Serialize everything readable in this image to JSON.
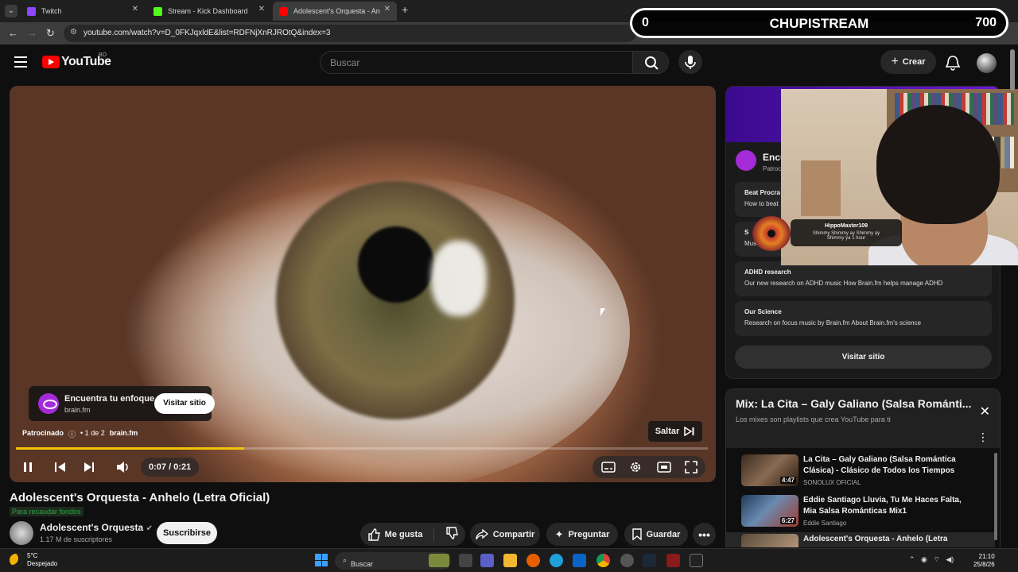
{
  "browser": {
    "tabs": [
      {
        "title": "Twitch",
        "color": "#9146ff"
      },
      {
        "title": "Stream - Kick Dashboard",
        "color": "#53fc18"
      },
      {
        "title": "Adolescent's Orquesta - An",
        "color": "#ff0000"
      }
    ],
    "url": "youtube.com/watch?v=D_0FKJqxldE&list=RDFNjXnRJROtQ&index=3"
  },
  "overlay": {
    "left": "0",
    "title": "CHUPISTREAM",
    "right": "700"
  },
  "youtube": {
    "logo": "YouTube",
    "country": "BO",
    "search_placeholder": "Buscar",
    "create_label": "Crear"
  },
  "player": {
    "ad_title": "Encuentra tu enfoque",
    "ad_domain": "brain.fm",
    "ad_visit": "Visitar sitio",
    "ad_sponsored": "Patrocinado",
    "ad_count": "• 1 de 2",
    "ad_domain2": "brain.fm",
    "skip_label": "Saltar",
    "time": "0:07 / 0:21",
    "progress": 0.33
  },
  "video": {
    "title": "Adolescent's Orquesta - Anhelo (Letra Oficial)",
    "fundraiser": "Para recaudar fondos",
    "channel": "Adolescent's Orquesta",
    "subscribers": "1.17 M de suscriptores",
    "subscribe": "Suscribirse",
    "actions": {
      "like": "Me gusta",
      "share": "Compartir",
      "ask": "Preguntar",
      "save": "Guardar"
    }
  },
  "side_ad": {
    "headline": "Encu",
    "sponsored": "Patroc",
    "links": [
      {
        "title": "Beat Procra",
        "desc": "How to beat"
      },
      {
        "title": "S",
        "desc": "Mus"
      },
      {
        "title": "ADHD research",
        "desc": "Our new research on ADHD music How Brain.fm helps manage ADHD"
      },
      {
        "title": "Our Science",
        "desc": "Research on focus music by Brain.fm About Brain.fm's science"
      }
    ],
    "visit": "Visitar sitio"
  },
  "donation": {
    "name": "HippoMaster109",
    "message_line1": "Shimmy Shimmy ay Shimmy ay",
    "message_line2": "Shimmy ya 1 hour"
  },
  "playlist": {
    "title": "Mix: La Cita – Galy Galiano (Salsa Románti...",
    "subtitle": "Los mixes son playlists que crea YouTube para ti",
    "items": [
      {
        "title": "La Cita – Galy Galiano (Salsa Romántica Clásica) - Clásico de Todos los Tiempos",
        "channel": "SONOLUX OFICIAL",
        "duration": "4:47"
      },
      {
        "title": "Eddie Santiago Lluvia, Tu Me Haces Falta, Mia Salsa Románticas Mix1",
        "channel": "Eddie Santiago",
        "duration": "6:27"
      },
      {
        "title": "Adolescent's Orquesta - Anhelo (Letra",
        "channel": "",
        "duration": ""
      }
    ]
  },
  "taskbar": {
    "temp": "5°C",
    "weather": "Despejado",
    "search": "Buscar",
    "time": "21:10",
    "date": "25/8/26"
  }
}
